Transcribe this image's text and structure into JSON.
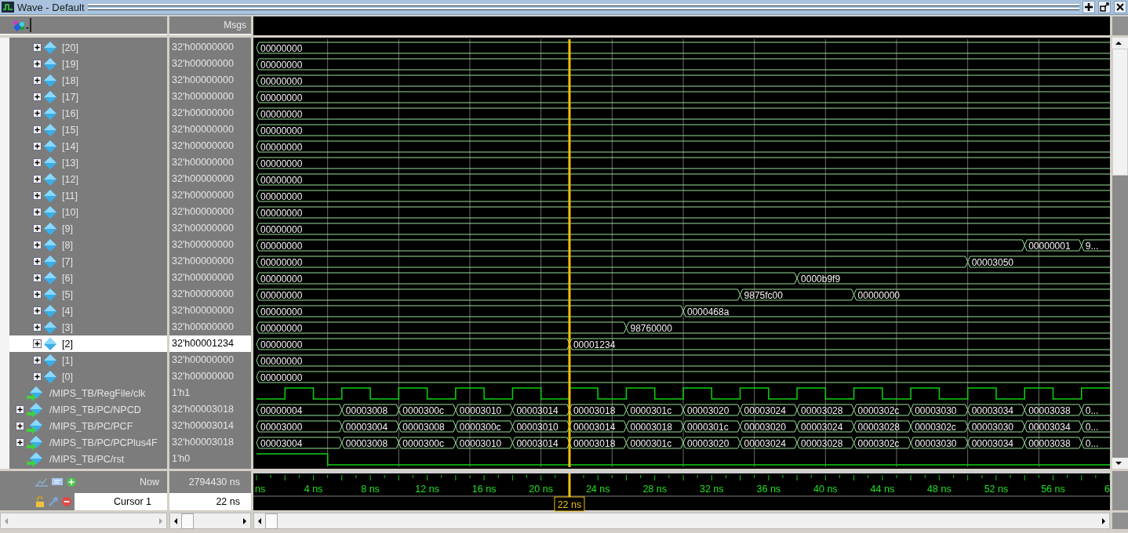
{
  "window": {
    "title": "Wave - Default"
  },
  "header": {
    "msgs_label": "Msgs"
  },
  "signals": [
    {
      "name": "[20]",
      "value": "32'h00000000",
      "kind": "element",
      "expanded": false,
      "selected": false,
      "wave": [
        {
          "kind": "change",
          "value": "00000000"
        }
      ]
    },
    {
      "name": "[19]",
      "value": "32'h00000000",
      "kind": "element",
      "expanded": false,
      "selected": false,
      "wave": [
        {
          "kind": "change",
          "value": "00000000"
        }
      ]
    },
    {
      "name": "[18]",
      "value": "32'h00000000",
      "kind": "element",
      "expanded": false,
      "selected": false,
      "wave": [
        {
          "kind": "change",
          "value": "00000000"
        }
      ]
    },
    {
      "name": "[17]",
      "value": "32'h00000000",
      "kind": "element",
      "expanded": false,
      "selected": false,
      "wave": [
        {
          "kind": "change",
          "value": "00000000"
        }
      ]
    },
    {
      "name": "[16]",
      "value": "32'h00000000",
      "kind": "element",
      "expanded": false,
      "selected": false,
      "wave": [
        {
          "kind": "change",
          "value": "00000000"
        }
      ]
    },
    {
      "name": "[15]",
      "value": "32'h00000000",
      "kind": "element",
      "expanded": false,
      "selected": false,
      "wave": [
        {
          "kind": "change",
          "value": "00000000"
        }
      ]
    },
    {
      "name": "[14]",
      "value": "32'h00000000",
      "kind": "element",
      "expanded": false,
      "selected": false,
      "wave": [
        {
          "kind": "change",
          "value": "00000000"
        }
      ]
    },
    {
      "name": "[13]",
      "value": "32'h00000000",
      "kind": "element",
      "expanded": false,
      "selected": false,
      "wave": [
        {
          "kind": "change",
          "value": "00000000"
        }
      ]
    },
    {
      "name": "[12]",
      "value": "32'h00000000",
      "kind": "element",
      "expanded": false,
      "selected": false,
      "wave": [
        {
          "kind": "change",
          "value": "00000000"
        }
      ]
    },
    {
      "name": "[11]",
      "value": "32'h00000000",
      "kind": "element",
      "expanded": false,
      "selected": false,
      "wave": [
        {
          "kind": "change",
          "value": "00000000"
        }
      ]
    },
    {
      "name": "[10]",
      "value": "32'h00000000",
      "kind": "element",
      "expanded": false,
      "selected": false,
      "wave": [
        {
          "kind": "change",
          "value": "00000000"
        }
      ]
    },
    {
      "name": "[9]",
      "value": "32'h00000000",
      "kind": "element",
      "expanded": false,
      "selected": false,
      "wave": [
        {
          "kind": "change",
          "value": "00000000"
        }
      ]
    },
    {
      "name": "[8]",
      "value": "32'h00000000",
      "kind": "element",
      "expanded": false,
      "selected": false,
      "wave": [
        {
          "kind": "change",
          "value": "00000000"
        },
        {
          "kind": "hold"
        },
        {
          "kind": "hold"
        },
        {
          "kind": "hold"
        },
        {
          "kind": "hold"
        },
        {
          "kind": "hold"
        },
        {
          "kind": "hold"
        },
        {
          "kind": "hold"
        },
        {
          "kind": "hold"
        },
        {
          "kind": "hold"
        },
        {
          "kind": "hold"
        },
        {
          "kind": "hold"
        },
        {
          "kind": "hold"
        },
        {
          "kind": "change",
          "value": "00000001"
        },
        {
          "kind": "change",
          "value": "9..."
        }
      ]
    },
    {
      "name": "[7]",
      "value": "32'h00000000",
      "kind": "element",
      "expanded": false,
      "selected": false,
      "wave": [
        {
          "kind": "change",
          "value": "00000000"
        },
        {
          "kind": "hold"
        },
        {
          "kind": "hold"
        },
        {
          "kind": "hold"
        },
        {
          "kind": "hold"
        },
        {
          "kind": "hold"
        },
        {
          "kind": "hold"
        },
        {
          "kind": "hold"
        },
        {
          "kind": "hold"
        },
        {
          "kind": "hold"
        },
        {
          "kind": "hold"
        },
        {
          "kind": "hold"
        },
        {
          "kind": "change",
          "value": "00003050"
        }
      ]
    },
    {
      "name": "[6]",
      "value": "32'h00000000",
      "kind": "element",
      "expanded": false,
      "selected": false,
      "wave": [
        {
          "kind": "change",
          "value": "00000000"
        },
        {
          "kind": "hold"
        },
        {
          "kind": "hold"
        },
        {
          "kind": "hold"
        },
        {
          "kind": "hold"
        },
        {
          "kind": "hold"
        },
        {
          "kind": "hold"
        },
        {
          "kind": "hold"
        },
        {
          "kind": "hold"
        },
        {
          "kind": "change",
          "value": "0000b9f9"
        }
      ]
    },
    {
      "name": "[5]",
      "value": "32'h00000000",
      "kind": "element",
      "expanded": false,
      "selected": false,
      "wave": [
        {
          "kind": "change",
          "value": "00000000"
        },
        {
          "kind": "hold"
        },
        {
          "kind": "hold"
        },
        {
          "kind": "hold"
        },
        {
          "kind": "hold"
        },
        {
          "kind": "hold"
        },
        {
          "kind": "hold"
        },
        {
          "kind": "hold"
        },
        {
          "kind": "change",
          "value": "9875fc00"
        },
        {
          "kind": "hold"
        },
        {
          "kind": "change",
          "value": "00000000"
        }
      ]
    },
    {
      "name": "[4]",
      "value": "32'h00000000",
      "kind": "element",
      "expanded": false,
      "selected": false,
      "wave": [
        {
          "kind": "change",
          "value": "00000000"
        },
        {
          "kind": "hold"
        },
        {
          "kind": "hold"
        },
        {
          "kind": "hold"
        },
        {
          "kind": "hold"
        },
        {
          "kind": "hold"
        },
        {
          "kind": "hold"
        },
        {
          "kind": "change",
          "value": "0000468a"
        }
      ]
    },
    {
      "name": "[3]",
      "value": "32'h00000000",
      "kind": "element",
      "expanded": false,
      "selected": false,
      "wave": [
        {
          "kind": "change",
          "value": "00000000"
        },
        {
          "kind": "hold"
        },
        {
          "kind": "hold"
        },
        {
          "kind": "hold"
        },
        {
          "kind": "hold"
        },
        {
          "kind": "hold"
        },
        {
          "kind": "change",
          "value": "98760000"
        }
      ]
    },
    {
      "name": "[2]",
      "value": "32'h00001234",
      "kind": "element",
      "expanded": false,
      "selected": true,
      "wave": [
        {
          "kind": "change",
          "value": "00000000"
        },
        {
          "kind": "hold"
        },
        {
          "kind": "hold"
        },
        {
          "kind": "hold"
        },
        {
          "kind": "hold"
        },
        {
          "kind": "change",
          "value": "00001234"
        }
      ]
    },
    {
      "name": "[1]",
      "value": "32'h00000000",
      "kind": "element",
      "expanded": false,
      "selected": false,
      "wave": [
        {
          "kind": "change",
          "value": "00000000"
        }
      ]
    },
    {
      "name": "[0]",
      "value": "32'h00000000",
      "kind": "element",
      "expanded": false,
      "selected": false,
      "wave": [
        {
          "kind": "change",
          "value": "00000000"
        }
      ]
    },
    {
      "name": "/MIPS_TB/RegFile/clk",
      "value": "1'h1",
      "kind": "bit-port",
      "selected": false,
      "wave": {
        "kind": "clock"
      }
    },
    {
      "name": "/MIPS_TB/PC/NPCD",
      "value": "32'h00003018",
      "kind": "bus-port",
      "expanded": false,
      "selected": false,
      "wave": [
        {
          "kind": "change",
          "value": "00000004"
        },
        {
          "kind": "change",
          "value": "00003008"
        },
        {
          "kind": "change",
          "value": "0000300c"
        },
        {
          "kind": "change",
          "value": "00003010"
        },
        {
          "kind": "change",
          "value": "00003014"
        },
        {
          "kind": "change",
          "value": "00003018"
        },
        {
          "kind": "change",
          "value": "0000301c"
        },
        {
          "kind": "change",
          "value": "00003020"
        },
        {
          "kind": "change",
          "value": "00003024"
        },
        {
          "kind": "change",
          "value": "00003028"
        },
        {
          "kind": "change",
          "value": "0000302c"
        },
        {
          "kind": "change",
          "value": "00003030"
        },
        {
          "kind": "change",
          "value": "00003034"
        },
        {
          "kind": "change",
          "value": "00003038"
        },
        {
          "kind": "change",
          "value": "0..."
        }
      ]
    },
    {
      "name": "/MIPS_TB/PC/PCF",
      "value": "32'h00003014",
      "kind": "bus-port",
      "expanded": false,
      "selected": false,
      "wave": [
        {
          "kind": "change",
          "value": "00003000"
        },
        {
          "kind": "change",
          "value": "00003004"
        },
        {
          "kind": "change",
          "value": "00003008"
        },
        {
          "kind": "change",
          "value": "0000300c"
        },
        {
          "kind": "change",
          "value": "00003010"
        },
        {
          "kind": "change",
          "value": "00003014"
        },
        {
          "kind": "change",
          "value": "00003018"
        },
        {
          "kind": "change",
          "value": "0000301c"
        },
        {
          "kind": "change",
          "value": "00003020"
        },
        {
          "kind": "change",
          "value": "00003024"
        },
        {
          "kind": "change",
          "value": "00003028"
        },
        {
          "kind": "change",
          "value": "0000302c"
        },
        {
          "kind": "change",
          "value": "00003030"
        },
        {
          "kind": "change",
          "value": "00003034"
        },
        {
          "kind": "change",
          "value": "0..."
        }
      ]
    },
    {
      "name": "/MIPS_TB/PC/PCPlus4F",
      "value": "32'h00003018",
      "kind": "bus-port",
      "expanded": false,
      "selected": false,
      "wave": [
        {
          "kind": "change",
          "value": "00003004"
        },
        {
          "kind": "change",
          "value": "00003008"
        },
        {
          "kind": "change",
          "value": "0000300c"
        },
        {
          "kind": "change",
          "value": "00003010"
        },
        {
          "kind": "change",
          "value": "00003014"
        },
        {
          "kind": "change",
          "value": "00003018"
        },
        {
          "kind": "change",
          "value": "0000301c"
        },
        {
          "kind": "change",
          "value": "00003020"
        },
        {
          "kind": "change",
          "value": "00003024"
        },
        {
          "kind": "change",
          "value": "00003028"
        },
        {
          "kind": "change",
          "value": "0000302c"
        },
        {
          "kind": "change",
          "value": "00003030"
        },
        {
          "kind": "change",
          "value": "00003034"
        },
        {
          "kind": "change",
          "value": "00003038"
        },
        {
          "kind": "change",
          "value": "0..."
        }
      ]
    },
    {
      "name": "/MIPS_TB/PC/rst",
      "value": "1'h0",
      "kind": "bit-port",
      "selected": false,
      "wave": {
        "kind": "reset"
      }
    }
  ],
  "now": {
    "label": "Now",
    "value": "2794430 ns"
  },
  "cursor": {
    "label": "Cursor 1",
    "value": "22 ns",
    "marker": "22 ns",
    "level": 0.3667
  },
  "time_axis": {
    "ticks": [
      "ns",
      "4 ns",
      "8 ns",
      "12 ns",
      "16 ns",
      "20 ns",
      "24 ns",
      "28 ns",
      "32 ns",
      "36 ns",
      "40 ns",
      "44 ns",
      "48 ns",
      "52 ns",
      "56 ns",
      "6"
    ]
  }
}
